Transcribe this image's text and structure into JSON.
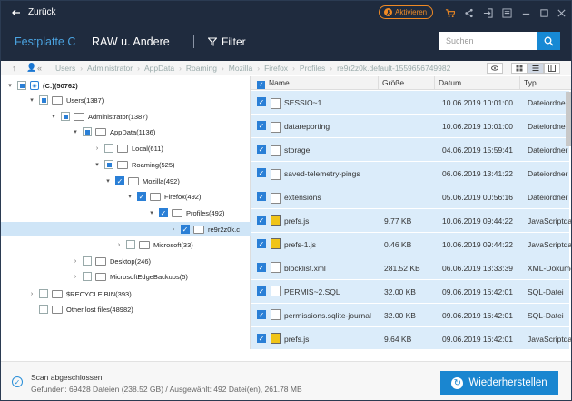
{
  "header": {
    "back_label": "Zurück",
    "activate_label": "Aktivieren",
    "tab_disk": "Festplatte C",
    "tab_raw": "RAW u. Andere",
    "filter_label": "Filter",
    "search_placeholder": "Suchen"
  },
  "breadcrumb": [
    "Users",
    "Administrator",
    "AppData",
    "Roaming",
    "Mozilla",
    "Firefox",
    "Profiles",
    "re9r2z0k.default-1559656749982"
  ],
  "tree": [
    {
      "label": "(C:)(50762)",
      "check": "partial",
      "expand": "▾"
    },
    {
      "label": "Users(1387)",
      "check": "partial",
      "expand": "▾"
    },
    {
      "label": "Administrator(1387)",
      "check": "partial",
      "expand": "▾"
    },
    {
      "label": "AppData(1136)",
      "check": "partial",
      "expand": "▾"
    },
    {
      "label": "Local(611)",
      "check": "none",
      "expand": "›"
    },
    {
      "label": "Roaming(525)",
      "check": "partial",
      "expand": "▾"
    },
    {
      "label": "Mozilla(492)",
      "check": "full",
      "expand": "▾"
    },
    {
      "label": "Firefox(492)",
      "check": "full",
      "expand": "▾"
    },
    {
      "label": "Profiles(492)",
      "check": "full",
      "expand": "▾"
    },
    {
      "label": "re9r2z0k.c",
      "check": "full",
      "expand": "›"
    },
    {
      "label": "Microsoft(33)",
      "check": "none",
      "expand": "›"
    },
    {
      "label": "Desktop(246)",
      "check": "none",
      "expand": "›"
    },
    {
      "label": "MicrosoftEdgeBackups(5)",
      "check": "none",
      "expand": "›"
    },
    {
      "label": "$RECYCLE.BIN(393)",
      "check": "none",
      "expand": "›"
    },
    {
      "label": "Other lost files(48982)",
      "check": "none",
      "expand": ""
    }
  ],
  "columns": {
    "name": "Name",
    "size": "Größe",
    "date": "Datum",
    "type": "Typ"
  },
  "files": [
    {
      "name": "SESSIO~1",
      "size": "",
      "date": "10.06.2019 10:01:00",
      "type": "Dateiordner",
      "icon": "folder"
    },
    {
      "name": "datareporting",
      "size": "",
      "date": "10.06.2019 10:01:00",
      "type": "Dateiordner",
      "icon": "folder"
    },
    {
      "name": "storage",
      "size": "",
      "date": "04.06.2019 15:59:41",
      "type": "Dateiordner",
      "icon": "folder"
    },
    {
      "name": "saved-telemetry-pings",
      "size": "",
      "date": "06.06.2019 13:41:22",
      "type": "Dateiordner",
      "icon": "folder"
    },
    {
      "name": "extensions",
      "size": "",
      "date": "05.06.2019 00:56:16",
      "type": "Dateiordner",
      "icon": "folder"
    },
    {
      "name": "prefs.js",
      "size": "9.77 KB",
      "date": "10.06.2019 09:44:22",
      "type": "JavaScriptdatei",
      "icon": "js"
    },
    {
      "name": "prefs-1.js",
      "size": "0.46 KB",
      "date": "10.06.2019 09:44:22",
      "type": "JavaScriptdatei",
      "icon": "js"
    },
    {
      "name": "blocklist.xml",
      "size": "281.52 KB",
      "date": "06.06.2019 13:33:39",
      "type": "XML-Dokument",
      "icon": "doc"
    },
    {
      "name": "PERMIS~2.SQL",
      "size": "32.00 KB",
      "date": "09.06.2019 16:42:01",
      "type": "SQL-Datei",
      "icon": "doc"
    },
    {
      "name": "permissions.sqlite-journal",
      "size": "32.00 KB",
      "date": "09.06.2019 16:42:01",
      "type": "SQL-Datei",
      "icon": "doc"
    },
    {
      "name": "prefs.js",
      "size": "9.64 KB",
      "date": "09.06.2019 16:42:01",
      "type": "JavaScriptdatei",
      "icon": "js"
    }
  ],
  "footer": {
    "status_title": "Scan abgeschlossen",
    "status_detail": "Gefunden: 69428 Dateien (238.52 GB) / Ausgewählt: 492 Datei(en), 261.78 MB",
    "restore_label": "Wiederherstellen"
  },
  "colors": {
    "header_bg": "#1f2b3e",
    "accent": "#1a86d0",
    "orange": "#f08a24",
    "row_selected": "#dbecfa"
  }
}
